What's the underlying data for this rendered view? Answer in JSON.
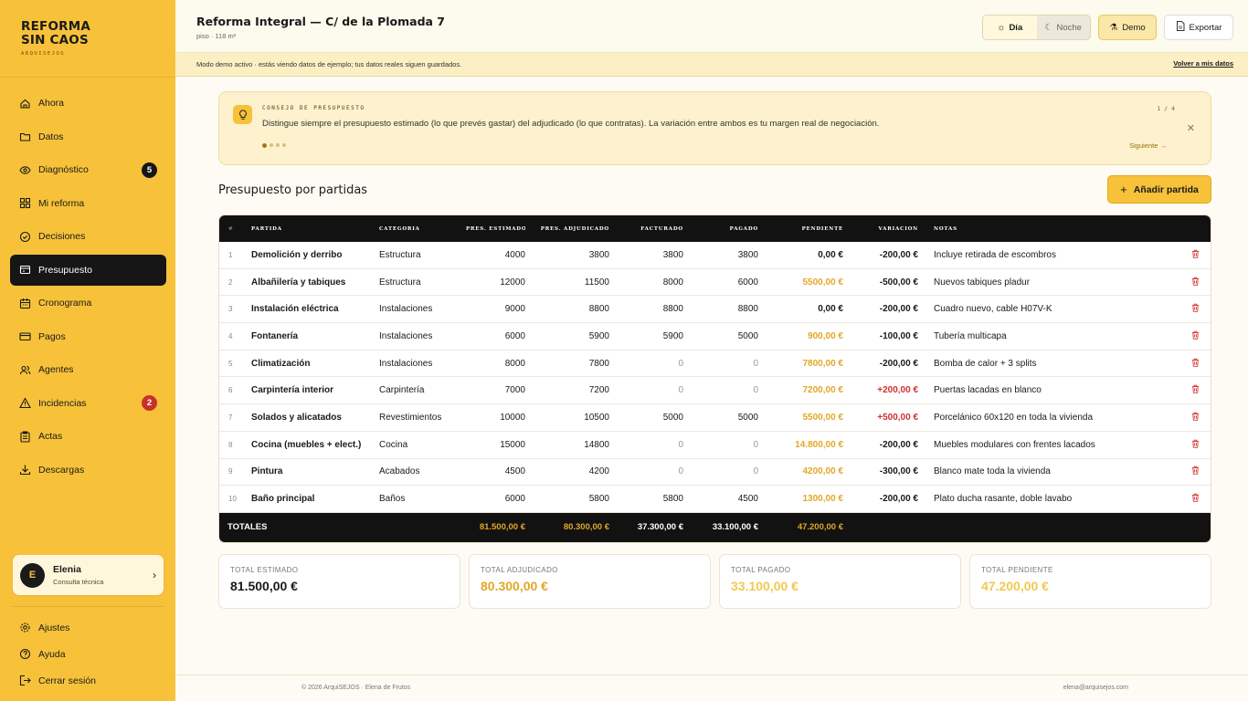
{
  "brand": {
    "line1": "REFORMA",
    "line2": "SIN CAOS",
    "sub": "ARQUISEJOS"
  },
  "nav": [
    {
      "label": "Ahora",
      "icon": "home-icon"
    },
    {
      "label": "Datos",
      "icon": "folder-icon"
    },
    {
      "label": "Diagnóstico",
      "icon": "eye-icon",
      "badge": "5",
      "badge_color": "#161616"
    },
    {
      "label": "Mi reforma",
      "icon": "grid-icon"
    },
    {
      "label": "Decisiones",
      "icon": "check-circle-icon"
    },
    {
      "label": "Presupuesto",
      "icon": "wallet-icon",
      "active": true
    },
    {
      "label": "Cronograma",
      "icon": "calendar-icon"
    },
    {
      "label": "Pagos",
      "icon": "credit-card-icon"
    },
    {
      "label": "Agentes",
      "icon": "users-icon"
    },
    {
      "label": "Incidencias",
      "icon": "alert-triangle-icon",
      "badge": "2",
      "badge_color": "#c8322a"
    },
    {
      "label": "Actas",
      "icon": "clipboard-icon"
    },
    {
      "label": "Descargas",
      "icon": "download-icon"
    }
  ],
  "user": {
    "initial": "E",
    "name": "Elenia",
    "role": "Consulta técnica"
  },
  "bottom_nav": [
    {
      "label": "Ajustes",
      "icon": "settings-icon"
    },
    {
      "label": "Ayuda",
      "icon": "help-icon"
    },
    {
      "label": "Cerrar sesión",
      "icon": "logout-icon"
    }
  ],
  "header": {
    "title": "Reforma Integral — C/ de la Plomada 7",
    "subtitle": "piso · 118 m²",
    "mode_day": "Día",
    "mode_night": "Noche",
    "demo": "Demo",
    "export": "Exportar"
  },
  "demo_bar": {
    "text": "Modo demo activo · estás viendo datos de ejemplo; tus datos reales siguen guardados.",
    "link": "Volver a mis datos"
  },
  "tip": {
    "kicker": "CONSEJO DE PRESUPUESTO",
    "text": "Distingue siempre el presupuesto estimado (lo que prevés gastar) del adjudicado (lo que contratas). La variación entre ambos es tu margen real de negociación.",
    "page": "1 / 4",
    "next": "Siguiente →"
  },
  "section_title": "Presupuesto por partidas",
  "add_button": "Añadir partida",
  "table": {
    "headers": [
      "#",
      "PARTIDA",
      "CATEGORÍA",
      "PRES. ESTIMADO",
      "PRES. ADJUDICADO",
      "FACTURADO",
      "PAGADO",
      "PENDIENTE",
      "VARIACIÓN",
      "NOTAS"
    ],
    "rows": [
      {
        "n": "1",
        "partida": "Demolición y derribo",
        "categoria": "Estructura",
        "estimado": "4000",
        "adjudicado": "3800",
        "facturado": "3800",
        "pagado": "3800",
        "pendiente": "0,00 €",
        "pend_color": "dark",
        "variacion": "-200,00 €",
        "var_pos": false,
        "notas": "Incluye retirada de escombros"
      },
      {
        "n": "2",
        "partida": "Albañilería y tabiques",
        "categoria": "Estructura",
        "estimado": "12000",
        "adjudicado": "11500",
        "facturado": "8000",
        "pagado": "6000",
        "pendiente": "5500,00 €",
        "pend_color": "gold",
        "variacion": "-500,00 €",
        "var_pos": false,
        "notas": "Nuevos tabiques pladur"
      },
      {
        "n": "3",
        "partida": "Instalación eléctrica",
        "categoria": "Instalaciones",
        "estimado": "9000",
        "adjudicado": "8800",
        "facturado": "8800",
        "pagado": "8800",
        "pendiente": "0,00 €",
        "pend_color": "dark",
        "variacion": "-200,00 €",
        "var_pos": false,
        "notas": "Cuadro nuevo, cable H07V-K"
      },
      {
        "n": "4",
        "partida": "Fontanería",
        "categoria": "Instalaciones",
        "estimado": "6000",
        "adjudicado": "5900",
        "facturado": "5900",
        "pagado": "5000",
        "pendiente": "900,00 €",
        "pend_color": "gold",
        "variacion": "-100,00 €",
        "var_pos": false,
        "notas": "Tubería multicapa"
      },
      {
        "n": "5",
        "partida": "Climatización",
        "categoria": "Instalaciones",
        "estimado": "8000",
        "adjudicado": "7800",
        "facturado": "0",
        "pagado": "0",
        "pendiente": "7800,00 €",
        "pend_color": "gold",
        "variacion": "-200,00 €",
        "var_pos": false,
        "notas": "Bomba de calor + 3 splits"
      },
      {
        "n": "6",
        "partida": "Carpintería interior",
        "categoria": "Carpintería",
        "estimado": "7000",
        "adjudicado": "7200",
        "facturado": "0",
        "pagado": "0",
        "pendiente": "7200,00 €",
        "pend_color": "gold",
        "variacion": "+200,00 €",
        "var_pos": true,
        "notas": "Puertas lacadas en blanco"
      },
      {
        "n": "7",
        "partida": "Solados y alicatados",
        "categoria": "Revestimientos",
        "estimado": "10000",
        "adjudicado": "10500",
        "facturado": "5000",
        "pagado": "5000",
        "pendiente": "5500,00 €",
        "pend_color": "gold",
        "variacion": "+500,00 €",
        "var_pos": true,
        "notas": "Porcelánico 60x120 en toda la vivienda"
      },
      {
        "n": "8",
        "partida": "Cocina (muebles + elect.)",
        "categoria": "Cocina",
        "estimado": "15000",
        "adjudicado": "14800",
        "facturado": "0",
        "pagado": "0",
        "pendiente": "14.800,00 €",
        "pend_color": "gold",
        "variacion": "-200,00 €",
        "var_pos": false,
        "notas": "Muebles modulares con frentes lacados"
      },
      {
        "n": "9",
        "partida": "Pintura",
        "categoria": "Acabados",
        "estimado": "4500",
        "adjudicado": "4200",
        "facturado": "0",
        "pagado": "0",
        "pendiente": "4200,00 €",
        "pend_color": "gold",
        "variacion": "-300,00 €",
        "var_pos": false,
        "notas": "Blanco mate toda la vivienda"
      },
      {
        "n": "10",
        "partida": "Baño principal",
        "categoria": "Baños",
        "estimado": "6000",
        "adjudicado": "5800",
        "facturado": "5800",
        "pagado": "4500",
        "pendiente": "1300,00 €",
        "pend_color": "gold",
        "variacion": "-200,00 €",
        "var_pos": false,
        "notas": "Plato ducha rasante, doble lavabo"
      }
    ],
    "totals": {
      "label": "TOTALES",
      "estimado": "81.500,00 €",
      "adjudicado": "80.300,00 €",
      "facturado": "37.300,00 €",
      "pagado": "33.100,00 €",
      "pendiente": "47.200,00 €"
    }
  },
  "cards": [
    {
      "label": "TOTAL ESTIMADO",
      "value": "81.500,00 €",
      "color": "#1a1a1a"
    },
    {
      "label": "TOTAL ADJUDICADO",
      "value": "80.300,00 €",
      "color": "#e2a726"
    },
    {
      "label": "TOTAL PAGADO",
      "value": "33.100,00 €",
      "color": "#f0c94f"
    },
    {
      "label": "TOTAL PENDIENTE",
      "value": "47.200,00 €",
      "color": "#f0c94f"
    }
  ],
  "footer": {
    "left": "© 2026 ArquiSEJOS · Elena de Frutos",
    "right": "elena@arquisejos.com"
  }
}
